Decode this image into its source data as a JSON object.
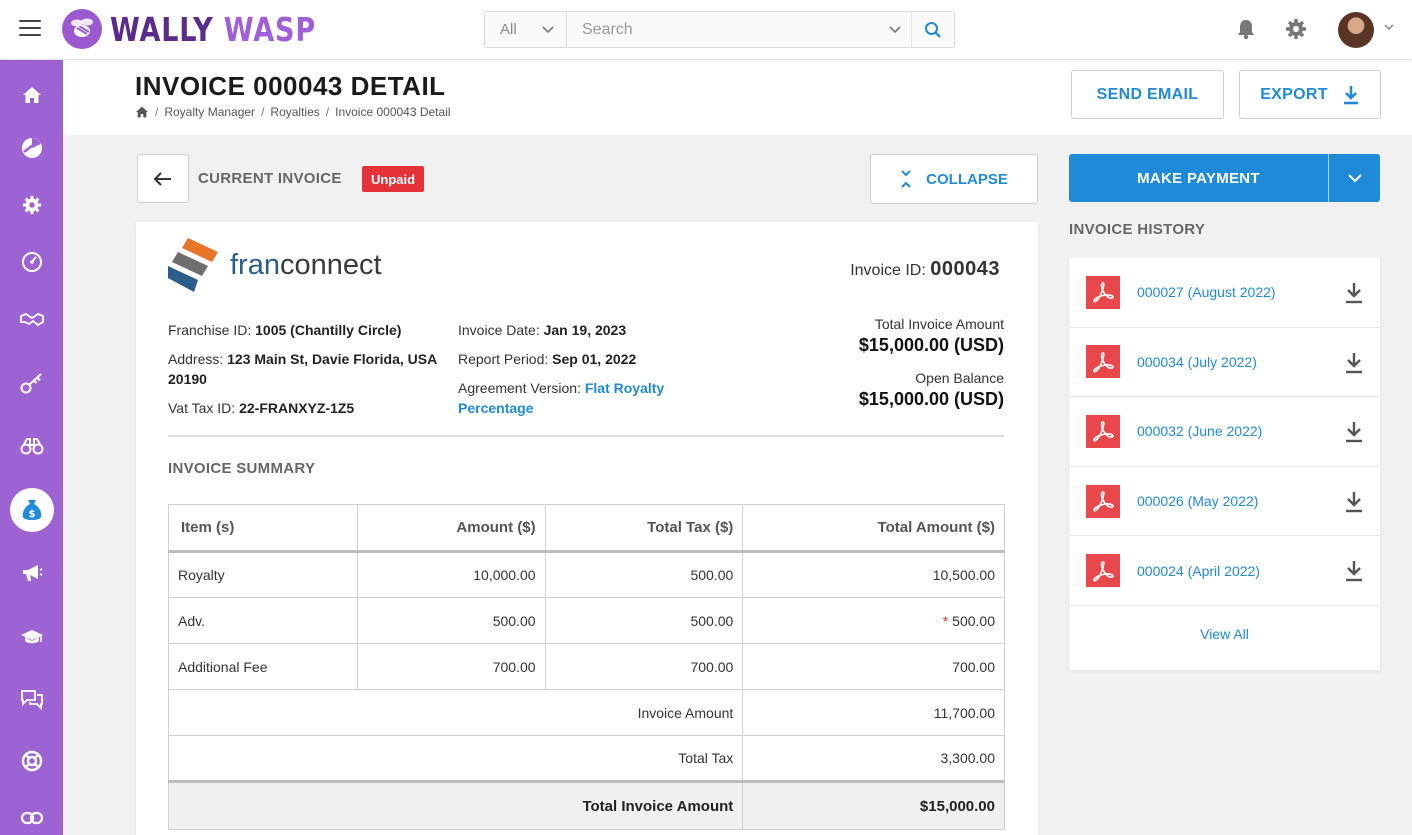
{
  "app": {
    "brand_word1": "WALLY",
    "brand_word2": "WASP"
  },
  "search": {
    "scope": "All",
    "placeholder": "Search"
  },
  "page": {
    "title": "INVOICE 000043 DETAIL",
    "breadcrumb": [
      "Royalty Manager",
      "Royalties",
      "Invoice 000043 Detail"
    ],
    "send_email": "SEND EMAIL",
    "export": "EXPORT"
  },
  "invoice_bar": {
    "label": "CURRENT INVOICE",
    "status": "Unpaid",
    "collapse": "COLLAPSE"
  },
  "invoice": {
    "logo_fran": "fran",
    "logo_connect": "connect",
    "id_label": "Invoice ID:",
    "id_value": "000043",
    "franchise_label": "Franchise ID:",
    "franchise_value": "1005 (Chantilly Circle)",
    "address_label": "Address:",
    "address_value": "123 Main St, Davie Florida, USA 20190",
    "vat_label": "Vat Tax ID:",
    "vat_value": "22-FRANXYZ-1Z5",
    "date_label": "Invoice Date:",
    "date_value": "Jan 19, 2023",
    "period_label": "Report Period:",
    "period_value": "Sep 01, 2022",
    "agreement_label": "Agreement Version:",
    "agreement_value": "Flat Royalty Percentage",
    "total_label": "Total Invoice Amount",
    "total_value": "$15,000.00 (USD)",
    "balance_label": "Open Balance",
    "balance_value": "$15,000.00 (USD)"
  },
  "summary": {
    "title": "INVOICE SUMMARY",
    "headers": [
      "Item (s)",
      "Amount ($)",
      "Total Tax ($)",
      "Total Amount ($)"
    ],
    "rows": [
      [
        "Royalty",
        "10,000.00",
        "500.00",
        "10,500.00"
      ],
      [
        "Adv.",
        "500.00",
        "500.00",
        "500.00"
      ],
      [
        "Additional Fee",
        "700.00",
        "700.00",
        "700.00"
      ]
    ],
    "invoice_amount_label": "Invoice Amount",
    "invoice_amount_value": "11,700.00",
    "total_tax_label": "Total Tax",
    "total_tax_value": "3,300.00",
    "total_label": "Total Invoice Amount",
    "total_value": "$15,000.00",
    "asterisk": "*"
  },
  "payment": {
    "button": "MAKE PAYMENT"
  },
  "history": {
    "title": "INVOICE HISTORY",
    "items": [
      "000027 (August 2022)",
      "000034 (July 2022)",
      "000032 (June 2022)",
      "000026 (May 2022)",
      "000024 (April 2022)"
    ],
    "view_all": "View All"
  },
  "colors": {
    "sidebar": "#9e63d2",
    "accent": "#1f8ad8",
    "badge": "#e53238"
  }
}
